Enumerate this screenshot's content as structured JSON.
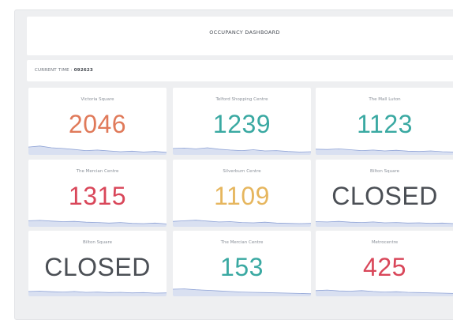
{
  "dashboard": {
    "title": "OCCUPANCY DASHBOARD",
    "subtitle": ""
  },
  "timebar": {
    "label": "CURRENT TIME : ",
    "value": "092623"
  },
  "colors": {
    "orange": "#e07a5a",
    "teal": "#3aa9a2",
    "red": "#d9475a",
    "yellow": "#e6b65e",
    "gray": "#4b4f55",
    "spark_fill": "#b9c6e6",
    "spark_line": "#8fa3d6"
  },
  "cards": [
    {
      "name": "Victoria Square",
      "value": "2046",
      "note": "",
      "color": "#e07a5a",
      "spark": [
        0.55,
        0.62,
        0.5,
        0.45,
        0.38,
        0.3,
        0.34,
        0.28,
        0.22,
        0.26,
        0.2,
        0.24,
        0.18
      ]
    },
    {
      "name": "Telford Shopping Centre",
      "value": "1239",
      "note": "",
      "color": "#3aa9a2",
      "spark": [
        0.45,
        0.48,
        0.42,
        0.5,
        0.4,
        0.34,
        0.3,
        0.36,
        0.28,
        0.3,
        0.24,
        0.2,
        0.22
      ]
    },
    {
      "name": "The Mall Luton",
      "value": "1123",
      "note": "",
      "color": "#3aa9a2",
      "spark": [
        0.4,
        0.38,
        0.42,
        0.36,
        0.3,
        0.34,
        0.28,
        0.32,
        0.26,
        0.24,
        0.28,
        0.22,
        0.2
      ]
    },
    {
      "name": "The Mercian Centre",
      "value": "1315",
      "note": "",
      "color": "#d9475a",
      "spark": [
        0.42,
        0.45,
        0.4,
        0.36,
        0.38,
        0.32,
        0.3,
        0.26,
        0.3,
        0.24,
        0.22,
        0.26,
        0.2
      ]
    },
    {
      "name": "Silverburn Centre",
      "value": "1109",
      "note": "",
      "color": "#e6b65e",
      "spark": [
        0.38,
        0.42,
        0.46,
        0.4,
        0.34,
        0.36,
        0.3,
        0.28,
        0.32,
        0.26,
        0.24,
        0.22,
        0.24
      ]
    },
    {
      "name": "Bilton Square",
      "value": "CLOSED",
      "note": "",
      "color": "#4b4f55",
      "spark": [
        0.36,
        0.34,
        0.38,
        0.32,
        0.3,
        0.34,
        0.28,
        0.3,
        0.26,
        0.28,
        0.24,
        0.26,
        0.22
      ]
    },
    {
      "name": "Bilton Square",
      "value": "CLOSED",
      "note": "",
      "color": "#4b4f55",
      "spark": [
        0.34,
        0.36,
        0.32,
        0.3,
        0.34,
        0.28,
        0.3,
        0.26,
        0.28,
        0.24,
        0.26,
        0.22,
        0.24
      ]
    },
    {
      "name": "The Mercian Centre",
      "value": "153",
      "note": "",
      "color": "#3aa9a2",
      "spark": [
        0.5,
        0.52,
        0.46,
        0.42,
        0.38,
        0.34,
        0.3,
        0.28,
        0.26,
        0.24,
        0.22,
        0.2,
        0.18
      ]
    },
    {
      "name": "Metrocentre",
      "value": "425",
      "note": "",
      "color": "#d9475a",
      "spark": [
        0.4,
        0.44,
        0.38,
        0.36,
        0.4,
        0.34,
        0.3,
        0.32,
        0.28,
        0.26,
        0.24,
        0.22,
        0.2
      ]
    }
  ]
}
